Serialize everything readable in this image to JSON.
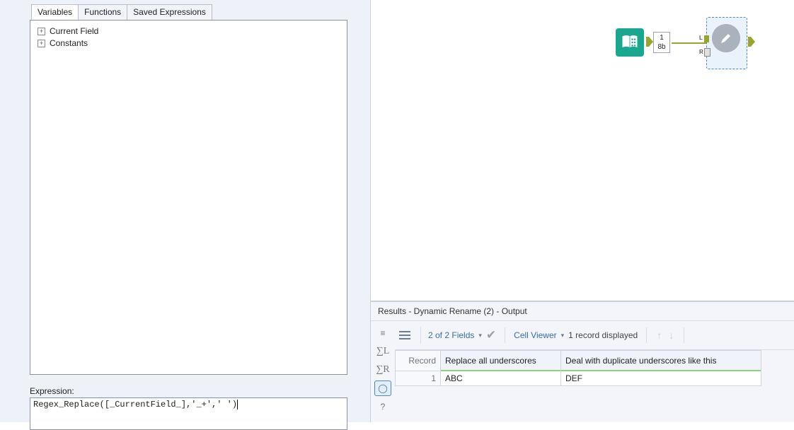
{
  "config": {
    "tabs": [
      "Variables",
      "Functions",
      "Saved Expressions"
    ],
    "active_tab": 0,
    "tree": {
      "items": [
        "Current Field",
        "Constants"
      ]
    },
    "expression_label": "Expression:",
    "expression_value": "Regex_Replace([_CurrentField_],'_+',' ')"
  },
  "canvas": {
    "input_tool_name": "text-input-tool",
    "annotation": {
      "line1": "1",
      "line2": "8b"
    },
    "selected_tool_name": "dynamic-rename-tool"
  },
  "results": {
    "title": "Results - Dynamic Rename (2) - Output",
    "fields_text": "2 of 2 Fields",
    "cell_viewer_text": "Cell Viewer",
    "records_text": "1 record displayed",
    "columns": [
      "Record",
      "Replace all underscores",
      "Deal with duplicate underscores like this"
    ],
    "rows": [
      {
        "record": "1",
        "cells": [
          "ABC",
          "DEF"
        ]
      }
    ],
    "side_buttons": {
      "all": "≡",
      "sigma_l": "∑L",
      "sigma_r": "∑R",
      "out": "◯",
      "help": "?"
    }
  }
}
